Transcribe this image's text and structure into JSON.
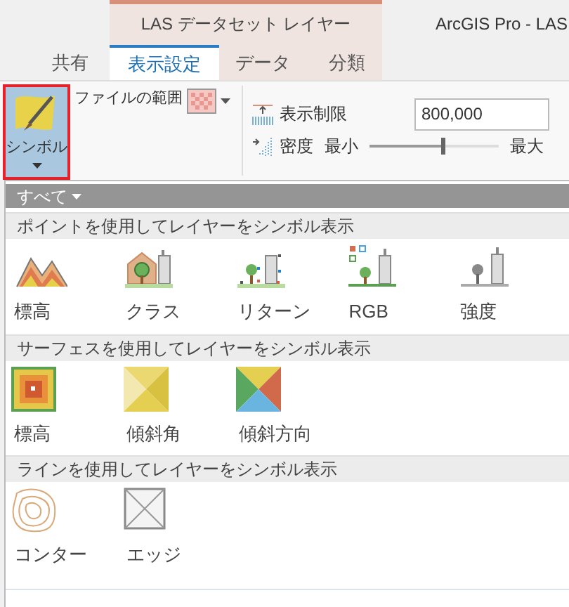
{
  "window": {
    "title": "ArcGIS Pro - LAS"
  },
  "contextual_tab_group": {
    "label": "LAS データセット レイヤー"
  },
  "tabs": [
    {
      "label": "共有",
      "selected": false
    },
    {
      "label": "表示設定",
      "selected": true
    },
    {
      "label": "データ",
      "selected": false
    },
    {
      "label": "分類",
      "selected": false
    }
  ],
  "ribbon": {
    "symbology_button": {
      "label": "シンボル",
      "pressed": true
    },
    "file_extent": {
      "label": "ファイルの範囲"
    },
    "display_limit": {
      "label": "表示制限",
      "value": "800,000"
    },
    "density": {
      "label": "密度",
      "min_label": "最小",
      "max_label": "最大",
      "level": 0.56
    }
  },
  "gallery": {
    "filter": "すべて",
    "sections": [
      {
        "title": "ポイントを使用してレイヤーをシンボル表示",
        "items": [
          {
            "label": "標高",
            "kind": "points-elevation"
          },
          {
            "label": "クラス",
            "kind": "points-class"
          },
          {
            "label": "リターン",
            "kind": "points-return"
          },
          {
            "label": "RGB",
            "kind": "points-rgb"
          },
          {
            "label": "強度",
            "kind": "points-intensity"
          }
        ]
      },
      {
        "title": "サーフェスを使用してレイヤーをシンボル表示",
        "items": [
          {
            "label": "標高",
            "kind": "surface-elevation"
          },
          {
            "label": "傾斜角",
            "kind": "surface-slope"
          },
          {
            "label": "傾斜方向",
            "kind": "surface-aspect"
          }
        ]
      },
      {
        "title": "ラインを使用してレイヤーをシンボル表示",
        "items": [
          {
            "label": "コンター",
            "kind": "line-contour"
          },
          {
            "label": "エッジ",
            "kind": "line-edge"
          }
        ]
      }
    ]
  }
}
